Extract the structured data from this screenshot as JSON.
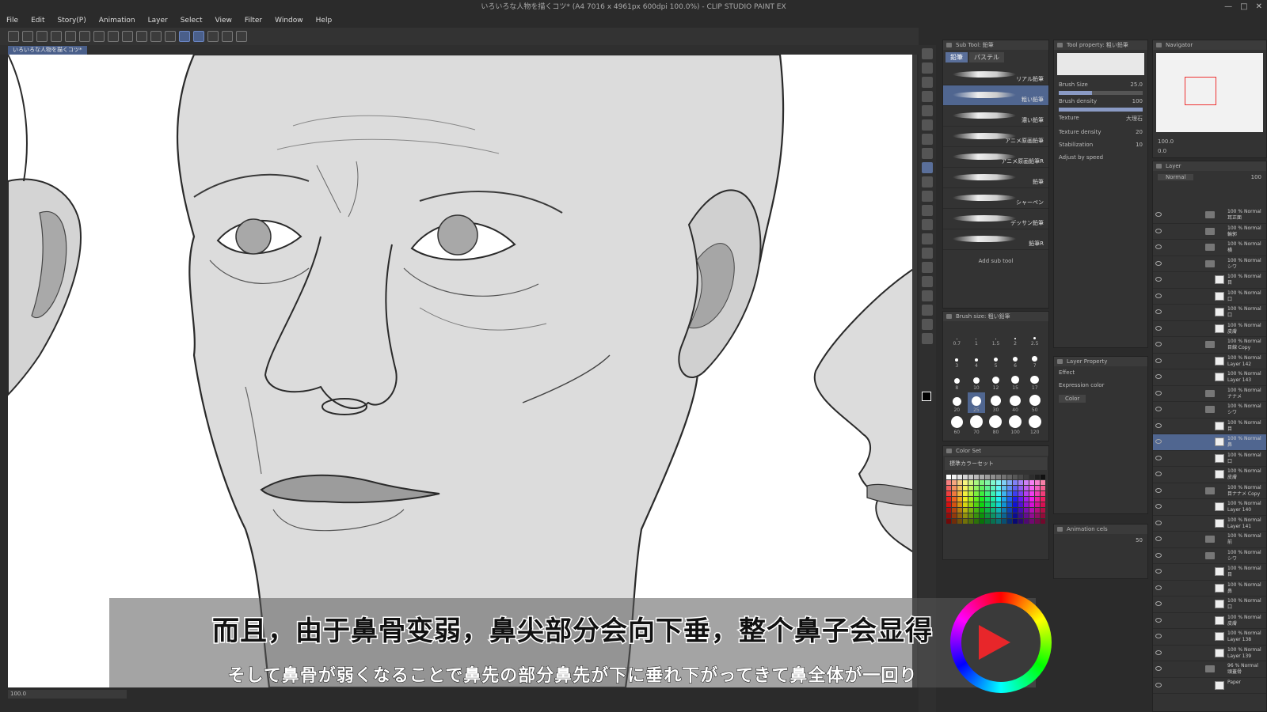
{
  "window": {
    "title": "いろいろな人物を描くコツ* (A4 7016 x 4961px 600dpi 100.0%) - CLIP STUDIO PAINT EX"
  },
  "menu": [
    "File",
    "Edit",
    "Story(P)",
    "Animation",
    "Layer",
    "Select",
    "View",
    "Filter",
    "Window",
    "Help"
  ],
  "document_tab": "いろいろな人物を描くコツ*",
  "statusbar": {
    "zoom": "100.0"
  },
  "sub_tool_panel": {
    "title": "Sub Tool: 鉛筆",
    "tabs": [
      "鉛筆",
      "パステル"
    ],
    "brushes": [
      "リアル鉛筆",
      "粗い鉛筆",
      "濃い鉛筆",
      "アニメ原画鉛筆",
      "アニメ原画鉛筆R",
      "鉛筆",
      "シャーペン",
      "デッサン鉛筆",
      "鉛筆R"
    ],
    "selected_index": 1,
    "add_sub_tool": "Add sub tool"
  },
  "tool_property": {
    "title": "Tool property: 粗い鉛筆",
    "brush_size_label": "Brush Size",
    "brush_size": "25.0",
    "brush_density_label": "Brush density",
    "brush_density": "100",
    "texture_label": "Texture",
    "texture_value": "大理石",
    "texture_density_label": "Texture density",
    "texture_density": "20",
    "stabilization_label": "Stabilization",
    "stabilization": "10",
    "adjust_speed": "Adjust by speed"
  },
  "brush_size_panel": {
    "title": "Brush size: 粗い鉛筆",
    "sizes": [
      "0.7",
      "1",
      "1.5",
      "2",
      "2.5",
      "3",
      "4",
      "5",
      "6",
      "7",
      "8",
      "10",
      "12",
      "15",
      "17",
      "20",
      "25",
      "30",
      "40",
      "50",
      "60",
      "70",
      "80",
      "100",
      "120"
    ],
    "selected": "25"
  },
  "layer_property": {
    "title": "Layer Property",
    "effect_label": "Effect",
    "expression_label": "Expression color",
    "expression_value": "Color"
  },
  "color_set": {
    "title": "Color Set",
    "set_name": "標準カラーセット"
  },
  "animation_cels": {
    "title": "Animation cels",
    "value": "50"
  },
  "navigator": {
    "title": "Navigator",
    "zoom": "100.0",
    "angle": "0.0"
  },
  "layer_panel": {
    "title": "Layer",
    "blend": "Normal",
    "opacity": "100",
    "layers": [
      {
        "text": "100 % Normal\n耳正面",
        "type": "folder"
      },
      {
        "text": "100 % Normal\n輪郭",
        "type": "folder"
      },
      {
        "text": "100 % Normal\n横",
        "type": "folder"
      },
      {
        "text": "100 % Normal\nシワ",
        "type": "folder"
      },
      {
        "text": "100 % Normal\n目",
        "type": "layer"
      },
      {
        "text": "100 % Normal\n口",
        "type": "layer"
      },
      {
        "text": "100 % Normal\n口",
        "type": "layer"
      },
      {
        "text": "100 % Normal\n皮膚",
        "type": "layer"
      },
      {
        "text": "100 % Normal\n目線 Copy",
        "type": "folder"
      },
      {
        "text": "100 % Normal\nLayer 142",
        "type": "layer"
      },
      {
        "text": "100 % Normal\nLayer 143",
        "type": "layer"
      },
      {
        "text": "100 % Normal\nナナメ",
        "type": "folder"
      },
      {
        "text": "100 % Normal\nシワ",
        "type": "folder"
      },
      {
        "text": "100 % Normal\n目",
        "type": "layer"
      },
      {
        "text": "100 % Normal\n鼻",
        "type": "layer",
        "selected": true
      },
      {
        "text": "100 % Normal\n口",
        "type": "layer"
      },
      {
        "text": "100 % Normal\n皮膚",
        "type": "layer"
      },
      {
        "text": "100 % Normal\n目ナナメ Copy",
        "type": "folder"
      },
      {
        "text": "100 % Normal\nLayer 140",
        "type": "layer"
      },
      {
        "text": "100 % Normal\nLayer 141",
        "type": "layer"
      },
      {
        "text": "100 % Normal\n前",
        "type": "folder"
      },
      {
        "text": "100 % Normal\nシワ",
        "type": "folder"
      },
      {
        "text": "100 % Normal\n目",
        "type": "layer"
      },
      {
        "text": "100 % Normal\n鼻",
        "type": "layer"
      },
      {
        "text": "100 % Normal\n口",
        "type": "layer"
      },
      {
        "text": "100 % Normal\n皮膚",
        "type": "layer"
      },
      {
        "text": "100 % Normal\nLayer 138",
        "type": "layer"
      },
      {
        "text": "100 % Normal\nLayer 139",
        "type": "layer"
      },
      {
        "text": "96 % Normal\n頭蓋骨",
        "type": "folder"
      },
      {
        "text": "Paper",
        "type": "layer"
      }
    ]
  },
  "subtitles": {
    "chinese": "而且，由于鼻骨变弱，鼻尖部分会向下垂，整个鼻子会显得",
    "japanese": "そして鼻骨が弱くなることで鼻先の部分鼻先が下に垂れ下がってきて鼻全体が一回り"
  },
  "colors": {
    "accent": "#506690",
    "panel": "#333333",
    "face_fill": "#dcdcdc",
    "line": "#2a2a2a"
  }
}
